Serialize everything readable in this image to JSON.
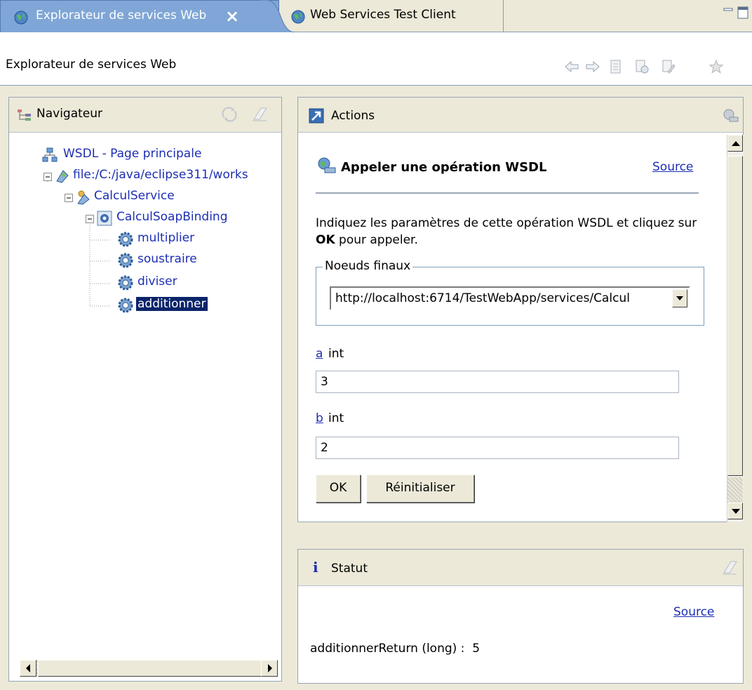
{
  "tabs": [
    {
      "label": "Explorateur de services Web",
      "close_icon": "×",
      "active": true
    },
    {
      "label": "Web Services Test Client",
      "active": false
    }
  ],
  "window_title": "Explorateur de services Web",
  "toolbar": {
    "icons": [
      "back-arrow-icon",
      "forward-arrow-icon",
      "page-icon",
      "page-refresh-icon",
      "lock-page-icon",
      "favorite-star-icon"
    ]
  },
  "navigator": {
    "title": "Navigateur",
    "tree": [
      {
        "label": "WSDL - Page principale",
        "level": 0
      },
      {
        "label": "file:/C:/java/eclipse311/works",
        "level": 1
      },
      {
        "label": "CalculService",
        "level": 2
      },
      {
        "label": "CalculSoapBinding",
        "level": 3
      },
      {
        "label": "multiplier",
        "level": 4
      },
      {
        "label": "soustraire",
        "level": 4
      },
      {
        "label": "diviser",
        "level": 4
      },
      {
        "label": "additionner",
        "level": 4,
        "selected": true
      }
    ]
  },
  "actions": {
    "title": "Actions",
    "heading": "Appeler une opération WSDL",
    "source_link": "Source",
    "instruction_prefix": "Indiquez les paramètres de cette opération WSDL et cliquez sur",
    "instruction_ok": "OK",
    "instruction_suffix": "pour appeler.",
    "endpoints_legend": "Noeuds finaux",
    "endpoint_selected": "http://localhost:6714/TestWebApp/services/Calcul",
    "params": [
      {
        "name": "a",
        "type": "int",
        "value": "3"
      },
      {
        "name": "b",
        "type": "int",
        "value": "2"
      }
    ],
    "ok_button": "OK",
    "reset_button": "Réinitialiser"
  },
  "status": {
    "title": "Statut",
    "info_glyph": "i",
    "source_link": "Source",
    "result": "additionnerReturn (long) :  5"
  }
}
